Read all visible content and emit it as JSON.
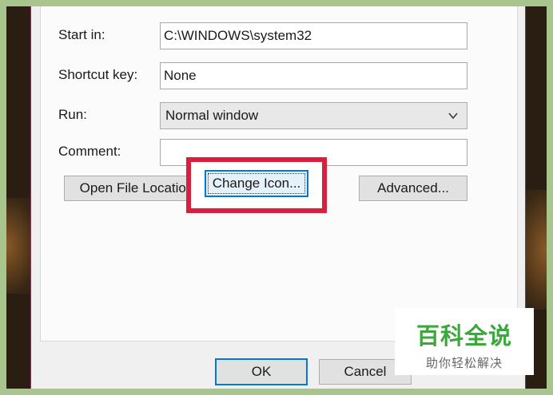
{
  "form": {
    "start_in_label": "Start in:",
    "start_in_value": "C:\\WINDOWS\\system32",
    "shortcut_key_label": "Shortcut key:",
    "shortcut_key_value": "None",
    "run_label": "Run:",
    "run_value": "Normal window",
    "comment_label": "Comment:",
    "comment_value": ""
  },
  "buttons": {
    "open_file_location": "Open File Location",
    "change_icon": "Change Icon...",
    "advanced": "Advanced...",
    "ok": "OK",
    "cancel": "Cancel"
  },
  "watermark": {
    "title": "百科全说",
    "subtitle": "助你轻松解决"
  },
  "colors": {
    "highlight": "#d8203c",
    "focus": "#0078d7",
    "watermark_green": "#3aa83a",
    "page_background": "#a8c58e"
  },
  "icons": {
    "run_dropdown": "chevron-down-icon"
  }
}
